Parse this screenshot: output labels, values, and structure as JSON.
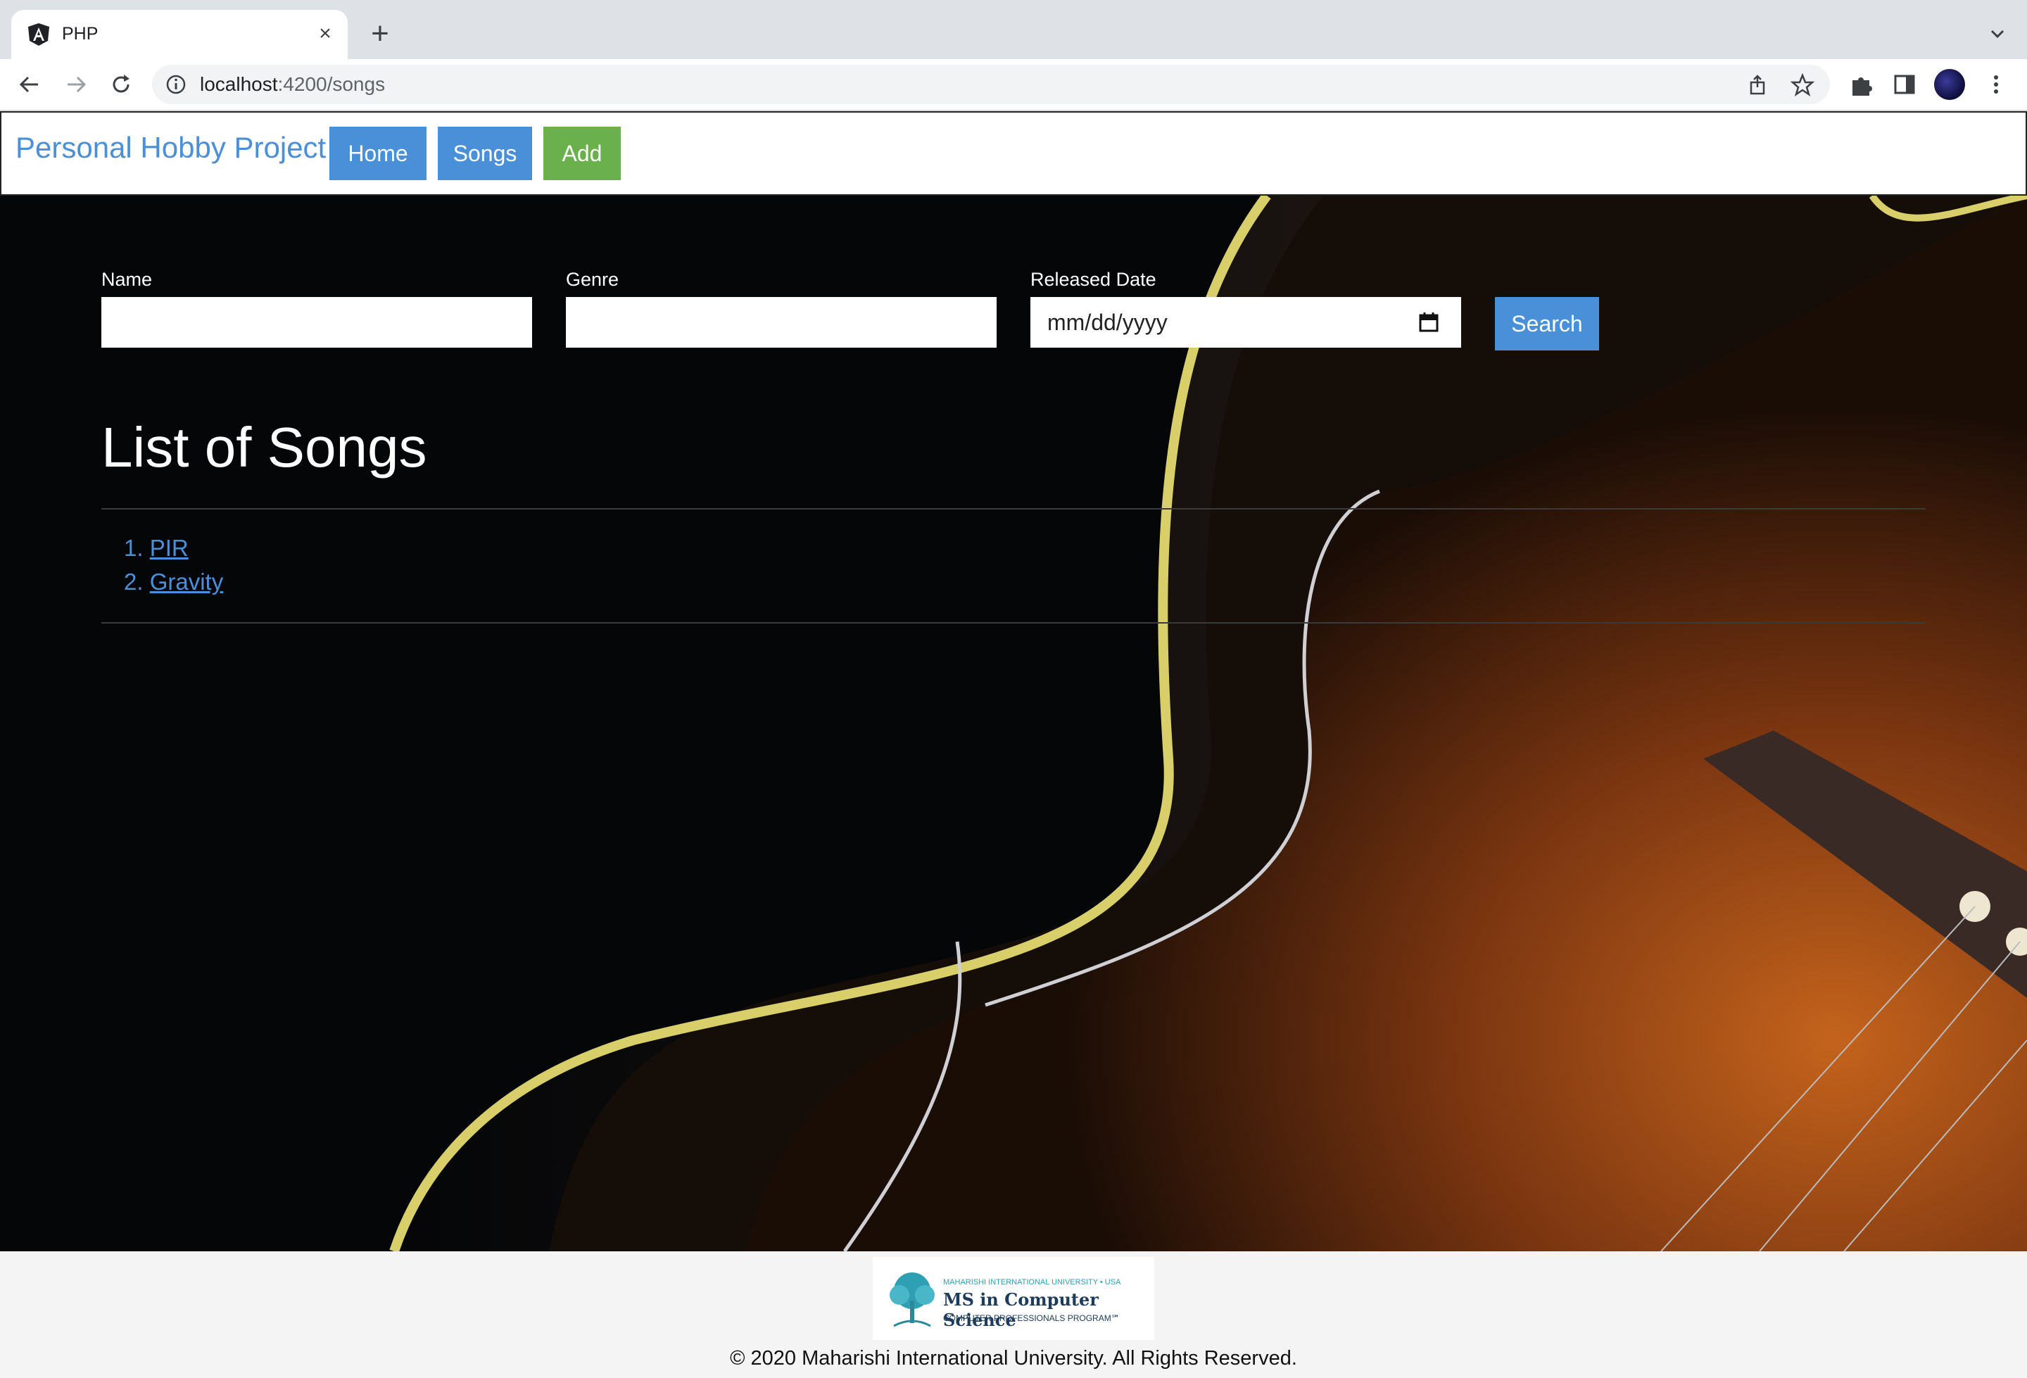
{
  "browser": {
    "tab_title": "PHP",
    "url_host": "localhost",
    "url_path": ":4200/songs"
  },
  "navbar": {
    "brand": "Personal Hobby Project",
    "buttons": [
      {
        "label": "Home",
        "color": "#4a90d9"
      },
      {
        "label": "Songs",
        "color": "#4a90d9"
      },
      {
        "label": "Add",
        "color": "#6ab04c"
      }
    ]
  },
  "search_form": {
    "name_label": "Name",
    "name_value": "",
    "genre_label": "Genre",
    "genre_value": "",
    "date_label": "Released Date",
    "date_placeholder": "mm/dd/yyyy",
    "search_button": "Search"
  },
  "songs": {
    "title": "List of Songs",
    "items": [
      {
        "number": "1.",
        "name": "PIR"
      },
      {
        "number": "2.",
        "name": "Gravity"
      }
    ]
  },
  "footer": {
    "logo_line1": "MAHARISHI INTERNATIONAL UNIVERSITY • USA",
    "logo_line2": "MS in Computer Science",
    "logo_line3": "COMPUTER PROFESSIONALS PROGRAM℠",
    "copyright": "© 2020 Maharishi International University. All Rights Reserved."
  }
}
